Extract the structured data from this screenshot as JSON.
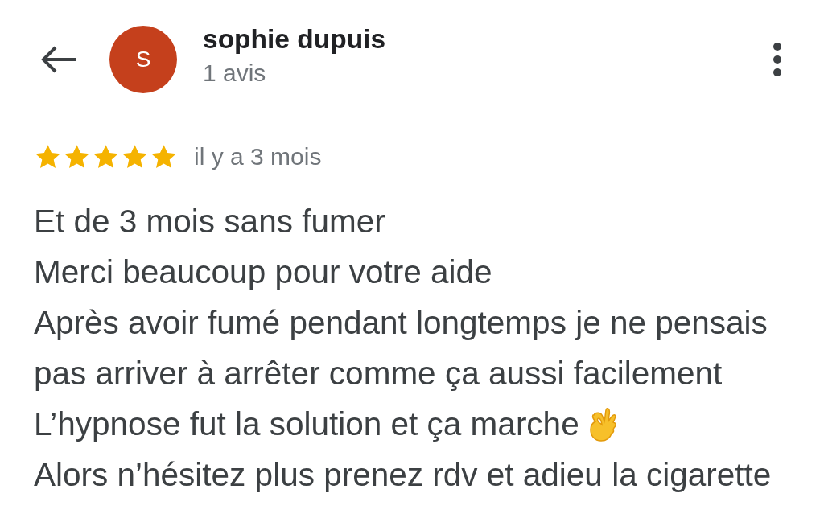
{
  "header": {
    "avatar_letter": "S",
    "name": "sophie dupuis",
    "subtitle": "1 avis"
  },
  "review": {
    "stars": 5,
    "date": "il y a 3 mois",
    "lines": [
      {
        "text": "Et de 3 mois sans fumer"
      },
      {
        "text": "Merci beaucoup pour votre aide"
      },
      {
        "text": "Après avoir fumé pendant longtemps je ne pensais"
      },
      {
        "text": "pas arriver à arrêter comme ça aussi facilement"
      },
      {
        "text": "L’hypnose fut la solution et ça marche",
        "kind": "ok-hand"
      },
      {
        "text": "Alors n’hésitez plus prenez rdv et adieu la cigarette"
      }
    ]
  }
}
